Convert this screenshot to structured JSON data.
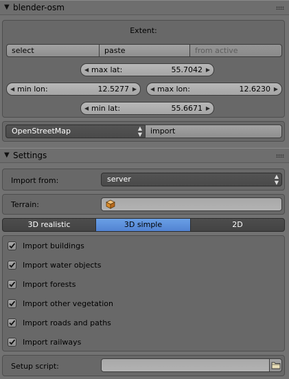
{
  "osm_panel": {
    "title": "blender-osm",
    "extent": {
      "heading": "Extent:",
      "select_label": "select",
      "paste_label": "paste",
      "from_active_label": "from active",
      "max_lat": {
        "label": "max lat:",
        "value": "55.7042"
      },
      "min_lon": {
        "label": "min lon:",
        "value": "12.5277"
      },
      "max_lon": {
        "label": "max lon:",
        "value": "12.6230"
      },
      "min_lat": {
        "label": "min lat:",
        "value": "55.6671"
      }
    },
    "source_select": "OpenStreetMap",
    "import_label": "import"
  },
  "settings_panel": {
    "title": "Settings",
    "import_from": {
      "label": "Import from:",
      "value": "server"
    },
    "terrain": {
      "label": "Terrain:",
      "value": ""
    },
    "modes": [
      {
        "label": "3D realistic",
        "active": false
      },
      {
        "label": "3D simple",
        "active": true
      },
      {
        "label": "2D",
        "active": false
      }
    ],
    "options": [
      {
        "label": "Import buildings",
        "checked": true
      },
      {
        "label": "Import water objects",
        "checked": true
      },
      {
        "label": "Import forests",
        "checked": true
      },
      {
        "label": "Import other vegetation",
        "checked": true
      },
      {
        "label": "Import roads and paths",
        "checked": true
      },
      {
        "label": "Import railways",
        "checked": true
      }
    ],
    "setup_script": {
      "label": "Setup script:",
      "value": ""
    }
  },
  "colors": {
    "panel_bg": "#727272",
    "active_accent": "#5e90dc",
    "dark_field": "#4e4e4e"
  }
}
